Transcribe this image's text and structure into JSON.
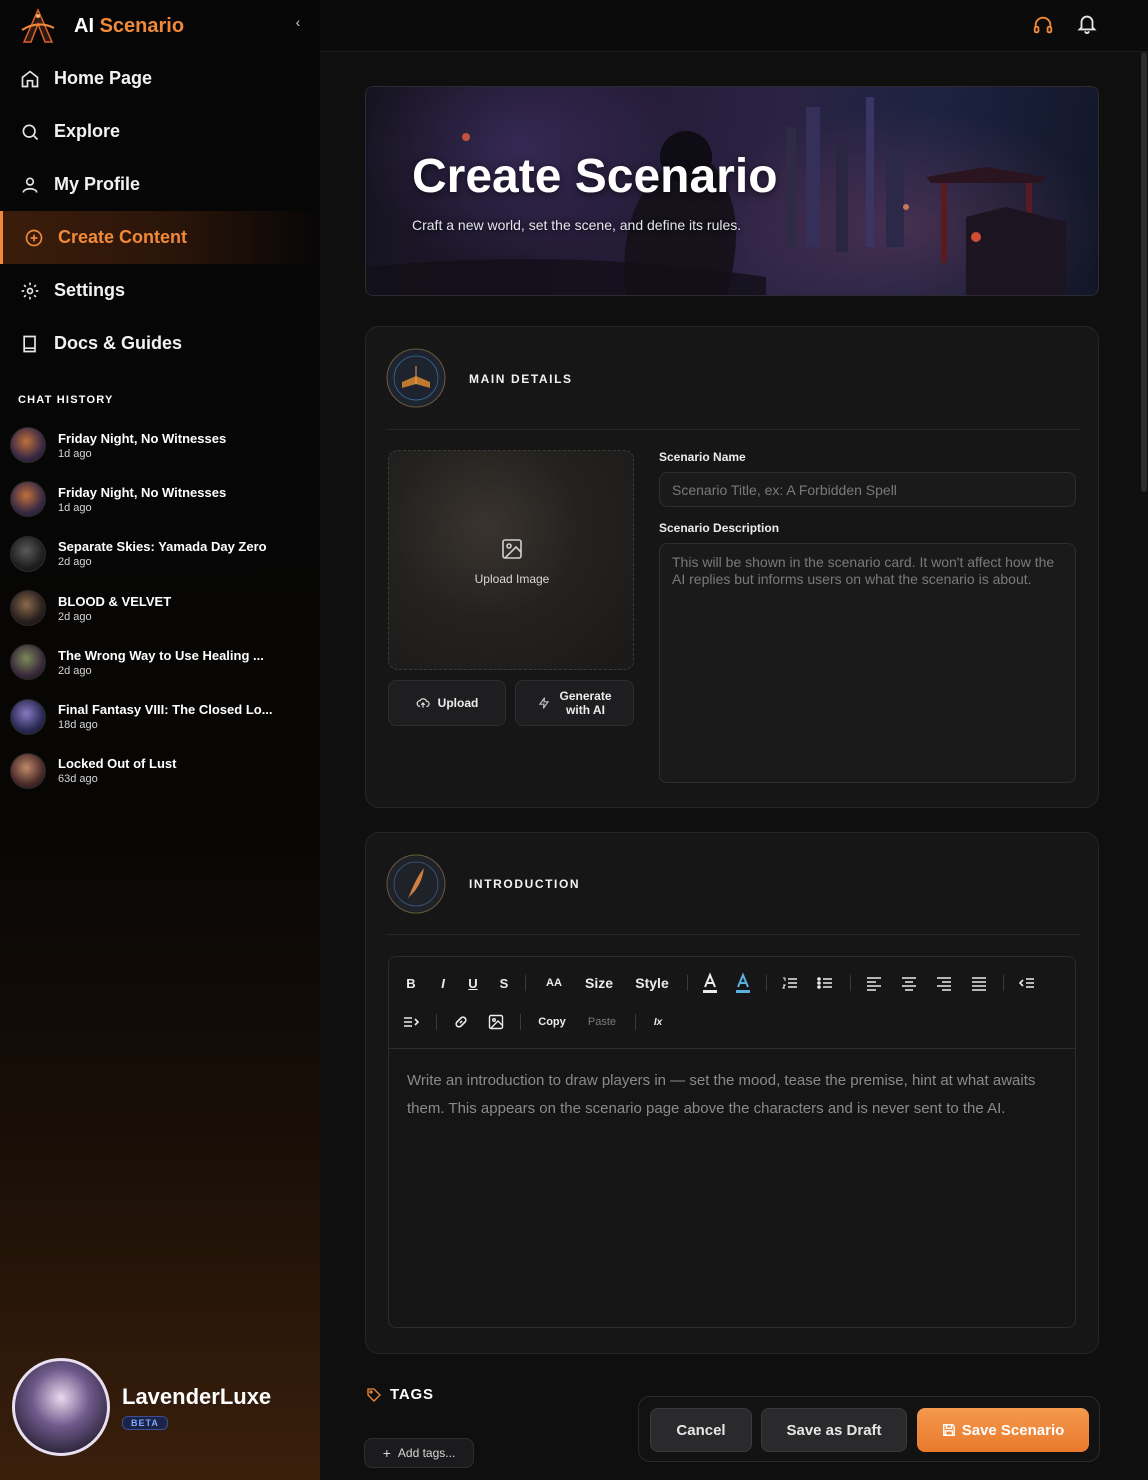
{
  "brand": {
    "prefix": "AI",
    "suffix": "Scenario",
    "collapse": "‹"
  },
  "nav": [
    {
      "label": "Home Page",
      "icon": "home-icon"
    },
    {
      "label": "Explore",
      "icon": "search-icon"
    },
    {
      "label": "My Profile",
      "icon": "user-icon"
    },
    {
      "label": "Create Content",
      "icon": "plus-circle-icon",
      "active": true
    },
    {
      "label": "Settings",
      "icon": "gear-icon"
    },
    {
      "label": "Docs & Guides",
      "icon": "book-icon"
    }
  ],
  "chat_history": {
    "title": "CHAT HISTORY",
    "items": [
      {
        "name": "Friday Night, No Witnesses",
        "time": "1d ago"
      },
      {
        "name": "Friday Night, No Witnesses",
        "time": "1d ago"
      },
      {
        "name": "Separate Skies: Yamada Day Zero",
        "time": "2d ago"
      },
      {
        "name": "BLOOD & VELVET",
        "time": "2d ago"
      },
      {
        "name": "The Wrong Way to Use Healing ...",
        "time": "2d ago"
      },
      {
        "name": "Final Fantasy VIII: The Closed Lo...",
        "time": "18d ago"
      },
      {
        "name": "Locked Out of Lust",
        "time": "63d ago"
      }
    ]
  },
  "profile": {
    "name": "LavenderLuxe",
    "badge": "BETA"
  },
  "topbar": {
    "icons": [
      "headphones-icon",
      "bell-icon"
    ]
  },
  "hero": {
    "title": "Create Scenario",
    "subtitle": "Craft a new world, set the scene, and define its rules."
  },
  "main_details": {
    "title": "MAIN DETAILS",
    "upload_image": "Upload Image",
    "upload_button": "Upload",
    "generate_button_line1": "Generate",
    "generate_button_line2": "with AI",
    "name_label": "Scenario Name",
    "name_placeholder": "Scenario Title, ex: A Forbidden Spell",
    "description_label": "Scenario Description",
    "description_placeholder": "This will be shown in the scenario card. It won't affect how the AI replies but informs users on what the scenario is about."
  },
  "introduction": {
    "title": "INTRODUCTION",
    "toolbar": {
      "bold": "B",
      "italic": "I",
      "underline": "U",
      "strike": "S",
      "font": "AA",
      "size": "Size",
      "style": "Style",
      "copy": "Copy",
      "paste": "Paste",
      "clear": "Ix"
    },
    "placeholder": "Write an introduction to draw players in — set the mood, tease the premise, hint at what awaits them. This appears on the scenario page above the characters and is never sent to the AI."
  },
  "tags": {
    "title": "TAGS",
    "add": "Add tags..."
  },
  "actions": {
    "cancel": "Cancel",
    "draft": "Save as Draft",
    "save": "Save Scenario"
  },
  "colors": {
    "accent": "#f08a3a",
    "background": "#0f0f10",
    "card": "#161617",
    "beta": "#7ea7ff"
  }
}
